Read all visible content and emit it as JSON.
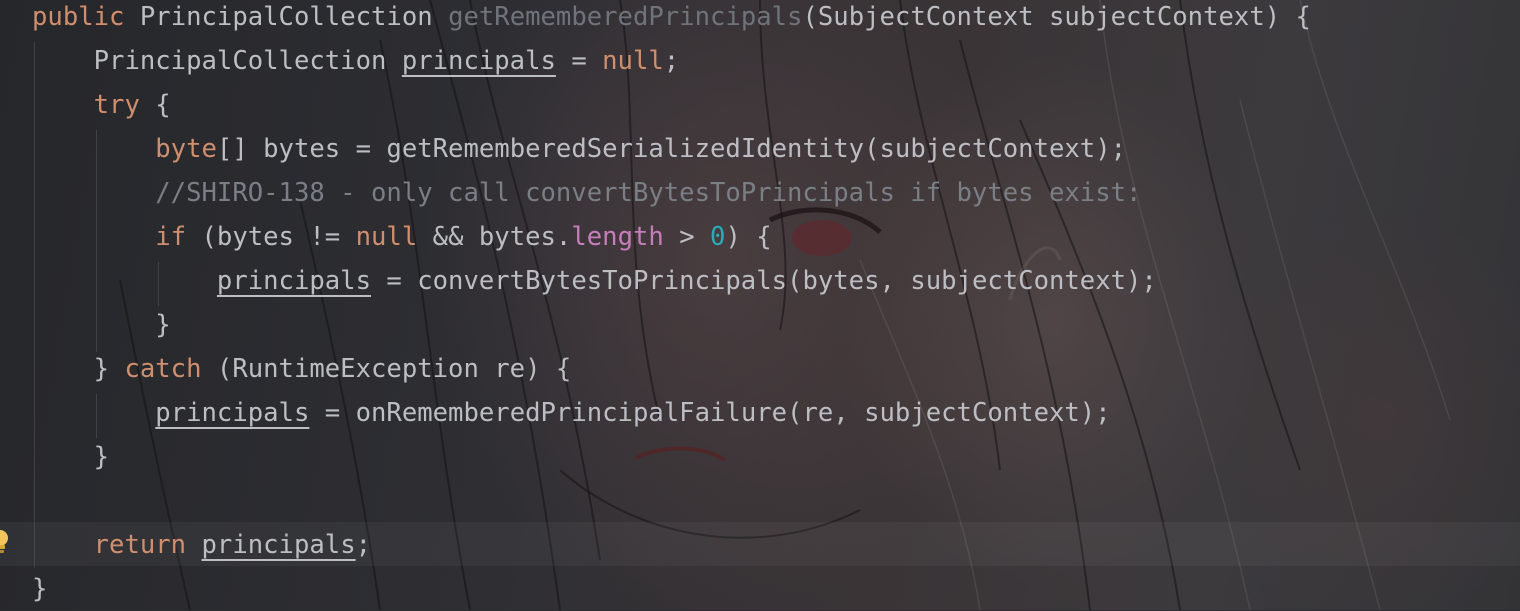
{
  "editor": {
    "language": "java",
    "intention_icon": "lightbulb-icon",
    "highlighted_line": 13,
    "lines": [
      {
        "tokens": [
          {
            "t": "public ",
            "c": "kw"
          },
          {
            "t": "PrincipalCollection ",
            "c": "plain"
          },
          {
            "t": "getRememberedPrincipals",
            "c": "fdecl"
          },
          {
            "t": "(SubjectContext subjectContext) {",
            "c": "plain"
          }
        ]
      },
      {
        "tokens": [
          {
            "t": "    PrincipalCollection ",
            "c": "plain"
          },
          {
            "t": "principals",
            "c": "plain",
            "u": true
          },
          {
            "t": " = ",
            "c": "plain"
          },
          {
            "t": "null",
            "c": "kw"
          },
          {
            "t": ";",
            "c": "plain"
          }
        ]
      },
      {
        "tokens": [
          {
            "t": "    ",
            "c": "plain"
          },
          {
            "t": "try",
            "c": "kw"
          },
          {
            "t": " {",
            "c": "plain"
          }
        ]
      },
      {
        "tokens": [
          {
            "t": "        ",
            "c": "plain"
          },
          {
            "t": "byte",
            "c": "kw"
          },
          {
            "t": "[] bytes = getRememberedSerializedIdentity(subjectContext);",
            "c": "plain"
          }
        ]
      },
      {
        "tokens": [
          {
            "t": "        //SHIRO-138 - only call convertBytesToPrincipals if bytes exist:",
            "c": "cmt"
          }
        ]
      },
      {
        "tokens": [
          {
            "t": "        ",
            "c": "plain"
          },
          {
            "t": "if",
            "c": "kw"
          },
          {
            "t": " (bytes != ",
            "c": "plain"
          },
          {
            "t": "null",
            "c": "kw"
          },
          {
            "t": " && bytes.",
            "c": "plain"
          },
          {
            "t": "length",
            "c": "field"
          },
          {
            "t": " > ",
            "c": "plain"
          },
          {
            "t": "0",
            "c": "num"
          },
          {
            "t": ") {",
            "c": "plain"
          }
        ]
      },
      {
        "tokens": [
          {
            "t": "            ",
            "c": "plain"
          },
          {
            "t": "principals",
            "c": "plain",
            "u": true
          },
          {
            "t": " = convertBytesToPrincipals(bytes, subjectContext);",
            "c": "plain"
          }
        ]
      },
      {
        "tokens": [
          {
            "t": "        }",
            "c": "plain"
          }
        ]
      },
      {
        "tokens": [
          {
            "t": "    } ",
            "c": "plain"
          },
          {
            "t": "catch",
            "c": "kw"
          },
          {
            "t": " (RuntimeException re) {",
            "c": "plain"
          }
        ]
      },
      {
        "tokens": [
          {
            "t": "        ",
            "c": "plain"
          },
          {
            "t": "principals",
            "c": "plain",
            "u": true
          },
          {
            "t": " = onRememberedPrincipalFailure(re, subjectContext);",
            "c": "plain"
          }
        ]
      },
      {
        "tokens": [
          {
            "t": "    }",
            "c": "plain"
          }
        ]
      },
      {
        "tokens": []
      },
      {
        "tokens": [
          {
            "t": "    ",
            "c": "plain"
          },
          {
            "t": "return",
            "c": "kw"
          },
          {
            "t": " ",
            "c": "plain"
          },
          {
            "t": "principals",
            "c": "plain",
            "u": true
          },
          {
            "t": ";",
            "c": "plain"
          }
        ]
      },
      {
        "tokens": [
          {
            "t": "}",
            "c": "plain"
          }
        ]
      }
    ]
  }
}
